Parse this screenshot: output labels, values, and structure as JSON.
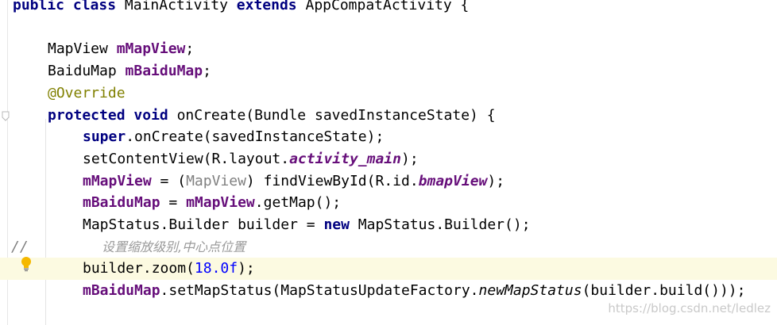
{
  "editor": {
    "lines": [
      {
        "indent": 0,
        "tokens": [
          {
            "t": "public",
            "c": "kw"
          },
          {
            "t": " ",
            "c": "pl"
          },
          {
            "t": "class",
            "c": "kw"
          },
          {
            "t": " MainActivity ",
            "c": "pl"
          },
          {
            "t": "extends",
            "c": "kw"
          },
          {
            "t": " AppCompatActivity {",
            "c": "pl"
          }
        ]
      },
      {
        "indent": 0,
        "tokens": []
      },
      {
        "indent": 1,
        "tokens": [
          {
            "t": "MapView ",
            "c": "pl"
          },
          {
            "t": "mMapView",
            "c": "fld"
          },
          {
            "t": ";",
            "c": "pl"
          }
        ]
      },
      {
        "indent": 1,
        "tokens": [
          {
            "t": "BaiduMap ",
            "c": "pl"
          },
          {
            "t": "mBaiduMap",
            "c": "fld"
          },
          {
            "t": ";",
            "c": "pl"
          }
        ]
      },
      {
        "indent": 1,
        "tokens": [
          {
            "t": "@Override",
            "c": "ann"
          }
        ]
      },
      {
        "indent": 1,
        "tokens": [
          {
            "t": "protected",
            "c": "kw"
          },
          {
            "t": " ",
            "c": "pl"
          },
          {
            "t": "void",
            "c": "kw"
          },
          {
            "t": " onCreate(Bundle savedInstanceState) {",
            "c": "pl"
          }
        ]
      },
      {
        "indent": 2,
        "tokens": [
          {
            "t": "super",
            "c": "kw"
          },
          {
            "t": ".onCreate(savedInstanceState);",
            "c": "pl"
          }
        ]
      },
      {
        "indent": 2,
        "tokens": [
          {
            "t": "setContentView(R.layout.",
            "c": "pl"
          },
          {
            "t": "activity_main",
            "c": "fldi"
          },
          {
            "t": ");",
            "c": "pl"
          }
        ]
      },
      {
        "indent": 2,
        "tokens": [
          {
            "t": "mMapView",
            "c": "fld"
          },
          {
            "t": " = (",
            "c": "pl"
          },
          {
            "t": "MapView",
            "c": "gray"
          },
          {
            "t": ") findViewById(R.id.",
            "c": "pl"
          },
          {
            "t": "bmapView",
            "c": "fldi"
          },
          {
            "t": ");",
            "c": "pl"
          }
        ]
      },
      {
        "indent": 2,
        "tokens": [
          {
            "t": "mBaiduMap",
            "c": "fld"
          },
          {
            "t": " = ",
            "c": "pl"
          },
          {
            "t": "mMapView",
            "c": "fld"
          },
          {
            "t": ".getMap();",
            "c": "pl"
          }
        ]
      },
      {
        "indent": 2,
        "tokens": [
          {
            "t": "MapStatus.Builder builder = ",
            "c": "pl"
          },
          {
            "t": "new",
            "c": "kw"
          },
          {
            "t": " MapStatus.Builder();",
            "c": "pl"
          }
        ]
      },
      {
        "indent": -1,
        "comment": {
          "slashes": "//",
          "text": "设置缩放级别,中心点位置"
        }
      },
      {
        "indent": 2,
        "caret": true,
        "tokens": [
          {
            "t": "builder.zoom(",
            "c": "pl"
          },
          {
            "t": "18.0f",
            "c": "num"
          },
          {
            "t": ");",
            "c": "pl"
          }
        ]
      },
      {
        "indent": 2,
        "tokens": [
          {
            "t": "mBaiduMap",
            "c": "fld"
          },
          {
            "t": ".setMapStatus(MapStatusUpdateFactory.",
            "c": "pl"
          },
          {
            "t": "newMapStatus",
            "c": "it"
          },
          {
            "t": "(builder.build()));",
            "c": "pl"
          }
        ]
      }
    ]
  },
  "icons": {
    "bulb": "lightbulb-icon",
    "fold": "fold-marker-icon"
  },
  "watermark": "https://blog.csdn.net/ledlez",
  "colors": {
    "keyword": "#000080",
    "field": "#660e7a",
    "annotation": "#808000",
    "number": "#0000ff",
    "comment": "#808080",
    "caret_line": "#fcfae1",
    "bulb": "#f5b800"
  }
}
